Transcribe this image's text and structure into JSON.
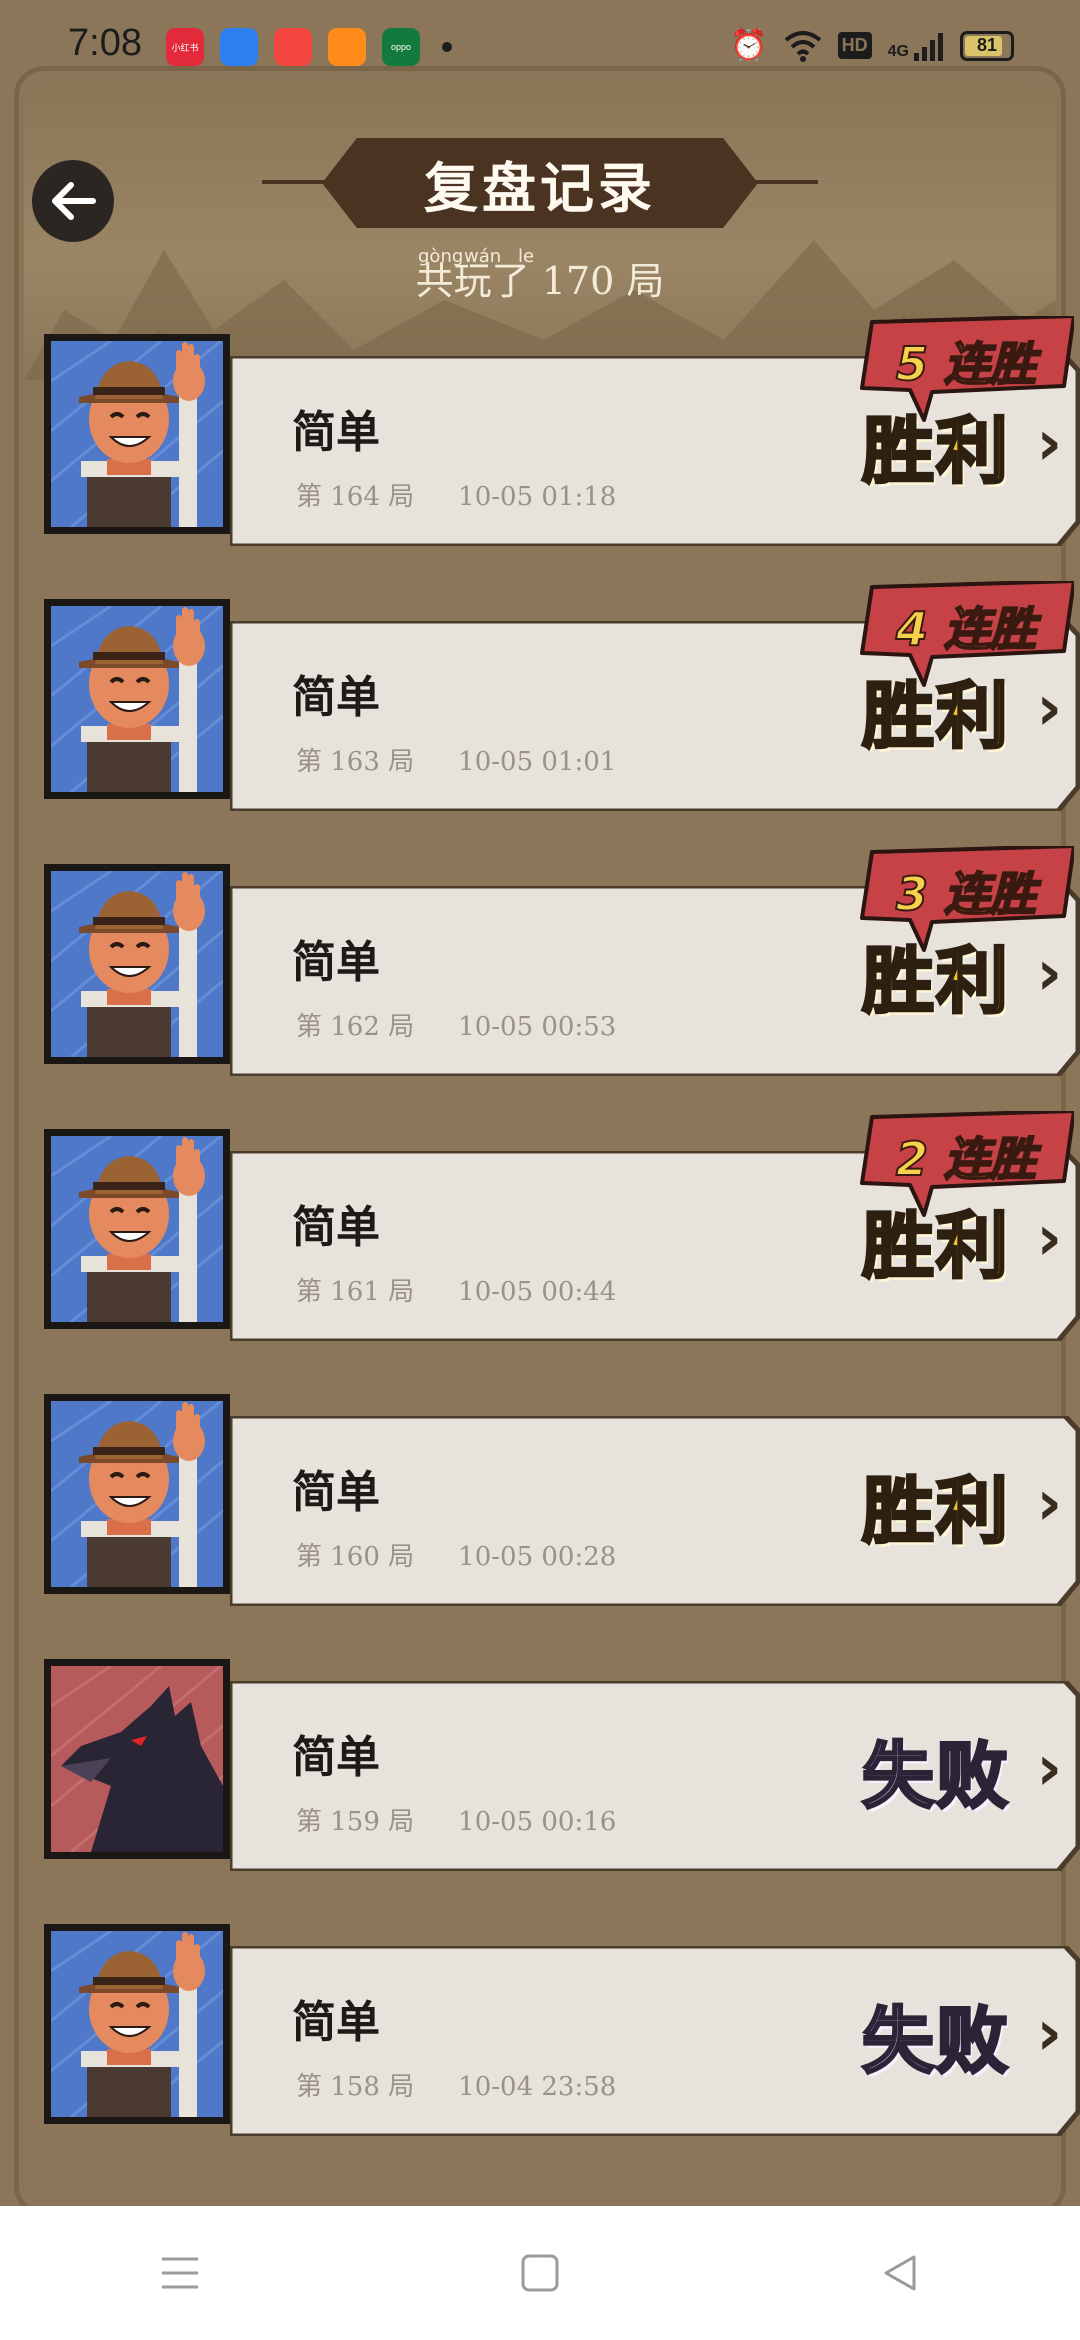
{
  "status_bar": {
    "time": "7:08",
    "apps": [
      {
        "name": "xiaohongshu-app-icon",
        "label": "小红书",
        "color": "#e32a3a"
      },
      {
        "name": "browser-app-icon",
        "label": "",
        "color": "#2d7ff0"
      },
      {
        "name": "video-app-icon",
        "label": "",
        "color": "#f2463e"
      },
      {
        "name": "camera-app-icon",
        "label": "",
        "color": "#ff8c1a"
      },
      {
        "name": "oppo-app-icon",
        "label": "oppo",
        "color": "#127a3c"
      }
    ],
    "hd": "HD",
    "network": "4G",
    "battery": "81"
  },
  "header": {
    "title": "复盘记录",
    "subtitle": "共玩了 170 局",
    "pinyin": [
      "gòng",
      "wán",
      "le"
    ]
  },
  "colors": {
    "background": "#8b7659",
    "card": "#e7e2dc",
    "win": "#f2c22e",
    "lose": "#bda7d9",
    "streak": "#c74246"
  },
  "records": [
    {
      "difficulty": "简单",
      "game_no": "第 164 局",
      "datetime": "10-05  01:18",
      "result": "胜利",
      "outcome": "win",
      "streak": "5 连胜",
      "role": "farmer"
    },
    {
      "difficulty": "简单",
      "game_no": "第 163 局",
      "datetime": "10-05  01:01",
      "result": "胜利",
      "outcome": "win",
      "streak": "4 连胜",
      "role": "farmer"
    },
    {
      "difficulty": "简单",
      "game_no": "第 162 局",
      "datetime": "10-05  00:53",
      "result": "胜利",
      "outcome": "win",
      "streak": "3 连胜",
      "role": "farmer"
    },
    {
      "difficulty": "简单",
      "game_no": "第 161 局",
      "datetime": "10-05  00:44",
      "result": "胜利",
      "outcome": "win",
      "streak": "2 连胜",
      "role": "farmer"
    },
    {
      "difficulty": "简单",
      "game_no": "第 160 局",
      "datetime": "10-05  00:28",
      "result": "胜利",
      "outcome": "win",
      "streak": "",
      "role": "farmer"
    },
    {
      "difficulty": "简单",
      "game_no": "第 159 局",
      "datetime": "10-05  00:16",
      "result": "失败",
      "outcome": "lose",
      "streak": "",
      "role": "wolf"
    },
    {
      "difficulty": "简单",
      "game_no": "第 158 局",
      "datetime": "10-04  23:58",
      "result": "失败",
      "outcome": "lose",
      "streak": "",
      "role": "farmer"
    }
  ],
  "nav": [
    "menu-nav-button",
    "home-nav-button",
    "back-nav-button"
  ]
}
